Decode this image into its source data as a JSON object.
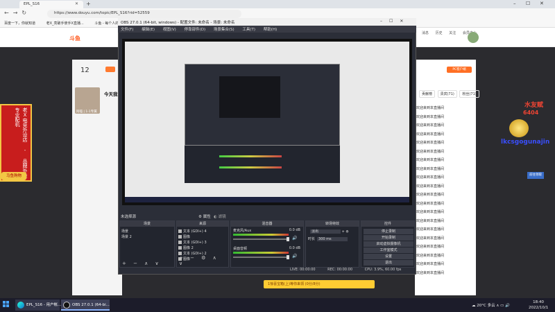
{
  "browser": {
    "tab_title": "EPL_S16",
    "url": "https://www.douyu.com/topic/EPL_S16?rid=52559",
    "bookmarks": [
      "百度一下，你就知道",
      "老X_亮破手使手X直播...",
      "斗鱼 - 每个人的直播平台"
    ]
  },
  "douyu": {
    "logo": "斗鱼",
    "header_items": [
      "消息",
      "历史",
      "关注",
      "会员中心"
    ],
    "viewer_count": "12",
    "today_text": "今天我",
    "cat_caption": "阿喵 | 1-1专属",
    "left_ad": "老X电竞外设店 - 品牌外设 专业配机",
    "left_ad_foot": "马鱼购物",
    "pc_button": "PC客户端",
    "right_tabs": [
      "贡献榜",
      "贵宾(71)",
      "粉丝(71)"
    ],
    "chat": [
      {
        "user": "",
        "msg": "欢迎来到本直播间"
      },
      {
        "user": "",
        "msg": "欢迎来到本直播间"
      },
      {
        "user": "",
        "msg": "欢迎来到本直播间"
      },
      {
        "user": "",
        "msg": "欢迎来到本直播间"
      },
      {
        "user": "",
        "msg": "欢迎来到本直播间"
      },
      {
        "user": "",
        "msg": "欢迎来到本直播间"
      },
      {
        "user": "",
        "msg": "欢迎来到本直播间"
      },
      {
        "user": "",
        "msg": "欢迎来到本直播间"
      },
      {
        "user": "",
        "msg": "欢迎来到本直播间"
      },
      {
        "user": "",
        "msg": "欢迎来到本直播间"
      },
      {
        "user": "",
        "msg": "欢迎来到本直播间"
      },
      {
        "user": "",
        "msg": "欢迎来到本直播间"
      },
      {
        "user": "",
        "msg": "欢迎来到本直播间"
      },
      {
        "user": "",
        "msg": "欢迎来到本直播间"
      },
      {
        "user": "",
        "msg": "欢迎来到本直播间"
      },
      {
        "user": "",
        "msg": "欢迎来到本直播间"
      },
      {
        "user": "",
        "msg": "欢迎来到本直播间"
      },
      {
        "user": "",
        "msg": "欢迎来到本直播间"
      },
      {
        "user": "",
        "msg": "欢迎来到本直播间"
      },
      {
        "user": "",
        "msg": "欢迎来到本直播间"
      }
    ],
    "overlay_line1": "水友赋",
    "overlay_line2": "6404",
    "overlay_name": "lkcsgogunajin",
    "overlay_btn": "前往领取",
    "gift_bar": "1惊喜宝箱(上)等你来领 (0分/8分)"
  },
  "obs": {
    "title": "OBS 27.0.1 (64-bit, windows) - 配置文件: 未命名 - 场景: 未命名",
    "menu": [
      "文件(F)",
      "编辑(E)",
      "视图(V)",
      "停靠部件(D)",
      "场景集合(S)",
      "工具(T)",
      "帮助(H)"
    ],
    "scene_label": "未选择源",
    "props_btn": "属性",
    "filters_btn": "滤镜",
    "docks": {
      "scenes": "场景",
      "sources": "来源",
      "mixer": "混音器",
      "transitions": "转场特效",
      "controls": "控件"
    },
    "scenes": [
      "场景",
      "场景 2"
    ],
    "sources": [
      "文本 (GDI+) 4",
      "图像",
      "文本 (GDI+) 3",
      "图像 2",
      "文本 (GDI+) 2",
      "图像"
    ],
    "mixer": [
      {
        "name": "麦克风/Aux",
        "db": "0.0 dB"
      },
      {
        "name": "桌面音频",
        "db": "0.0 dB"
      }
    ],
    "transition": {
      "type": "淡出",
      "duration_label": "时长",
      "duration": "300 ms"
    },
    "controls": [
      "停止录制",
      "开始录制",
      "启动虚拟摄像机",
      "工作室模式",
      "设置",
      "退出"
    ],
    "footer": {
      "live": "LIVE: 00:00:00",
      "rec": "REC: 00:00:00",
      "cpu": "CPU: 3.9%, 60.00 fps"
    }
  },
  "taskbar": {
    "apps": [
      "EPL_S16 - 用户帐...",
      "OBS 27.0.1 (64-bi..."
    ],
    "tray": "20°C 多云",
    "time": "18:40",
    "date": "2022/10/1"
  }
}
